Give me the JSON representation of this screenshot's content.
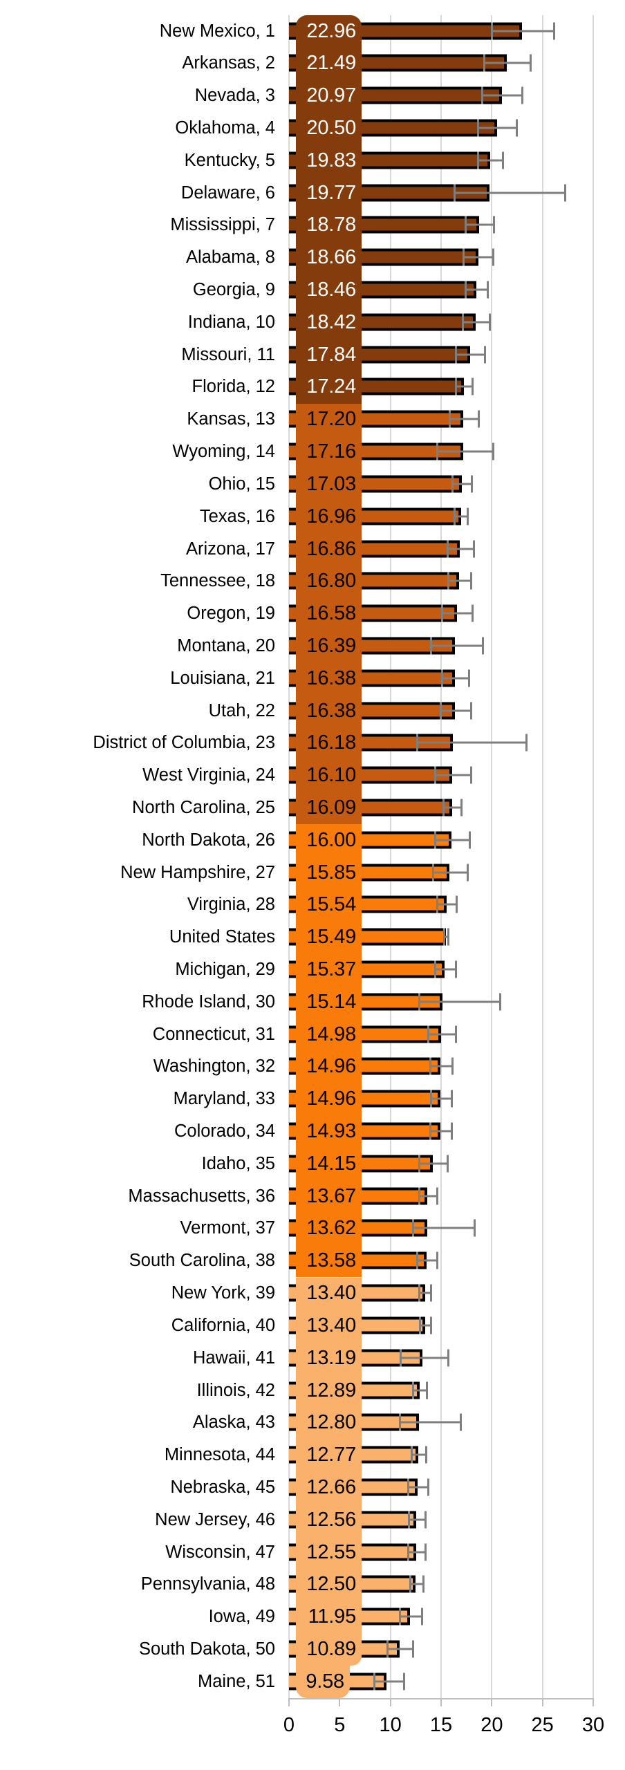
{
  "chart_data": {
    "type": "bar",
    "orientation": "horizontal",
    "title": "",
    "subtitle": "",
    "xlabel": "",
    "ylabel": "",
    "xlim": [
      0,
      30
    ],
    "xticks": [
      0,
      5,
      10,
      15,
      20,
      25,
      30
    ],
    "xtick_labels": [
      "0",
      "5",
      "10",
      "15",
      "20",
      "25",
      "30"
    ],
    "grid": true,
    "legend": null,
    "value_labels_shown": true,
    "error_bars": true,
    "categories": [
      "New Mexico, 1",
      "Arkansas, 2",
      "Nevada, 3",
      "Oklahoma, 4",
      "Kentucky, 5",
      "Delaware, 6",
      "Mississippi, 7",
      "Alabama, 8",
      "Georgia, 9",
      "Indiana, 10",
      "Missouri, 11",
      "Florida, 12",
      "Kansas, 13",
      "Wyoming, 14",
      "Ohio, 15",
      "Texas, 16",
      "Arizona, 17",
      "Tennessee, 18",
      "Oregon, 19",
      "Montana, 20",
      "Louisiana, 21",
      "Utah, 22",
      "District of Columbia, 23",
      "West Virginia, 24",
      "North Carolina, 25",
      "North Dakota, 26",
      "New Hampshire, 27",
      "Virginia, 28",
      "United States",
      "Michigan, 29",
      "Rhode Island, 30",
      "Connecticut, 31",
      "Washington, 32",
      "Maryland, 33",
      "Colorado, 34",
      "Idaho, 35",
      "Massachusetts, 36",
      "Vermont, 37",
      "South Carolina, 38",
      "New York, 39",
      "California, 40",
      "Hawaii, 41",
      "Illinois, 42",
      "Alaska, 43",
      "Minnesota, 44",
      "Nebraska, 45",
      "New Jersey, 46",
      "Wisconsin, 47",
      "Pennsylvania, 48",
      "Iowa, 49",
      "South Dakota, 50",
      "Maine, 51"
    ],
    "values": [
      22.96,
      21.49,
      20.97,
      20.5,
      19.83,
      19.77,
      18.78,
      18.66,
      18.46,
      18.42,
      17.84,
      17.24,
      17.2,
      17.16,
      17.03,
      16.96,
      16.86,
      16.8,
      16.58,
      16.39,
      16.38,
      16.38,
      16.18,
      16.1,
      16.09,
      16.0,
      15.85,
      15.54,
      15.49,
      15.37,
      15.14,
      14.98,
      14.96,
      14.96,
      14.93,
      14.15,
      13.67,
      13.62,
      13.58,
      13.4,
      13.4,
      13.19,
      12.89,
      12.8,
      12.77,
      12.66,
      12.56,
      12.55,
      12.5,
      11.95,
      10.89,
      9.58
    ],
    "value_labels": [
      "22.96",
      "21.49",
      "20.97",
      "20.50",
      "19.83",
      "19.77",
      "18.78",
      "18.66",
      "18.46",
      "18.42",
      "17.84",
      "17.24",
      "17.20",
      "17.16",
      "17.03",
      "16.96",
      "16.86",
      "16.80",
      "16.58",
      "16.39",
      "16.38",
      "16.38",
      "16.18",
      "16.10",
      "16.09",
      "16.00",
      "15.85",
      "15.54",
      "15.49",
      "15.37",
      "15.14",
      "14.98",
      "14.96",
      "14.96",
      "14.93",
      "14.15",
      "13.67",
      "13.62",
      "13.58",
      "13.40",
      "13.40",
      "13.19",
      "12.89",
      "12.80",
      "12.77",
      "12.66",
      "12.56",
      "12.55",
      "12.50",
      "11.95",
      "10.89",
      "9.58"
    ],
    "ci_low": [
      20.0,
      19.2,
      19.0,
      18.6,
      18.6,
      16.3,
      17.4,
      17.2,
      17.4,
      17.1,
      16.4,
      16.4,
      15.8,
      14.6,
      16.1,
      16.3,
      15.6,
      15.7,
      15.1,
      14.0,
      15.1,
      14.9,
      12.6,
      14.4,
      15.2,
      14.4,
      14.2,
      14.6,
      15.3,
      14.4,
      12.8,
      13.7,
      13.9,
      14.0,
      13.9,
      12.8,
      12.8,
      12.2,
      12.6,
      12.8,
      12.9,
      11.0,
      12.2,
      10.9,
      12.1,
      11.7,
      11.8,
      11.7,
      11.9,
      10.9,
      9.7,
      8.4
    ],
    "ci_high": [
      26.1,
      23.8,
      23.0,
      22.4,
      21.1,
      27.2,
      20.2,
      20.1,
      19.6,
      19.8,
      19.3,
      18.1,
      18.7,
      20.1,
      18.0,
      17.6,
      18.2,
      17.9,
      18.1,
      19.1,
      17.7,
      17.9,
      23.4,
      17.9,
      17.0,
      17.8,
      17.6,
      16.5,
      15.7,
      16.4,
      20.8,
      16.4,
      16.1,
      16.0,
      16.0,
      15.6,
      14.6,
      18.3,
      14.6,
      14.0,
      14.0,
      15.7,
      13.6,
      16.9,
      13.5,
      13.7,
      13.4,
      13.4,
      13.2,
      13.1,
      12.2,
      11.3
    ],
    "color_bands": [
      {
        "label": "rank-group-1",
        "from": 0,
        "to": 11,
        "fill": "#843C0C",
        "text": "#ffffff"
      },
      {
        "label": "rank-group-2",
        "from": 12,
        "to": 24,
        "fill": "#C55A11",
        "text": "#000000"
      },
      {
        "label": "rank-group-3",
        "from": 25,
        "to": 38,
        "fill": "#F97B0A",
        "text": "#000000"
      },
      {
        "label": "rank-group-4",
        "from": 39,
        "to": 51,
        "fill": "#F9B16B",
        "text": "#000000"
      }
    ],
    "colors": {
      "bar_outline": "#000000",
      "error_bar": "#7f7f7f",
      "axis": "#bfbfbf",
      "gridline": "#d9d9d9",
      "background": "#ffffff"
    }
  }
}
